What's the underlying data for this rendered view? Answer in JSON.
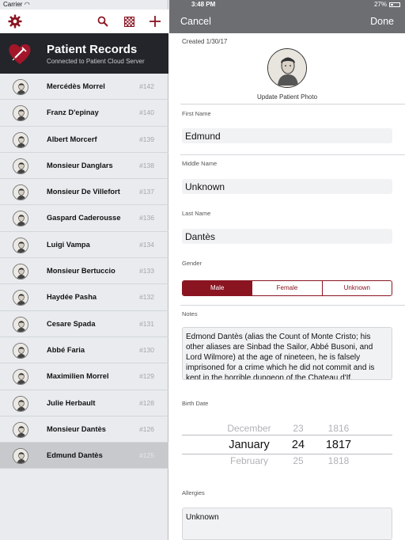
{
  "status_bar": {
    "carrier": "Carrier",
    "time": "3:48 PM",
    "battery": "27%"
  },
  "toolbar": {
    "icons": [
      "gear-icon",
      "search-icon",
      "checkerboard-icon",
      "plus-icon"
    ]
  },
  "header": {
    "title": "Patient Records",
    "subtitle": "Connected to Patient Cloud Server"
  },
  "patients": [
    {
      "name": "Mercédès Morrel",
      "id": "#142"
    },
    {
      "name": "Franz D'epinay",
      "id": "#140"
    },
    {
      "name": "Albert Morcerf",
      "id": "#139"
    },
    {
      "name": "Monsieur Danglars",
      "id": "#138"
    },
    {
      "name": "Monsieur De Villefort",
      "id": "#137"
    },
    {
      "name": "Gaspard Caderousse",
      "id": "#136"
    },
    {
      "name": "Luigi Vampa",
      "id": "#134"
    },
    {
      "name": "Monsieur  Bertuccio",
      "id": "#133"
    },
    {
      "name": "Haydée Pasha",
      "id": "#132"
    },
    {
      "name": "Cesare Spada",
      "id": "#131"
    },
    {
      "name": "Abbé Faria",
      "id": "#130"
    },
    {
      "name": "Maximilien Morrel",
      "id": "#129"
    },
    {
      "name": "Julie Herbault",
      "id": "#128"
    },
    {
      "name": "Monsieur Dantès",
      "id": "#126"
    },
    {
      "name": "Edmund Dantès",
      "id": "#125"
    }
  ],
  "detail": {
    "nav": {
      "cancel": "Cancel",
      "done": "Done"
    },
    "created": "Created 1/30/17",
    "photo_label": "Update Patient Photo",
    "first_name": {
      "label": "First Name",
      "value": "Edmund"
    },
    "middle_name": {
      "label": "Middle Name",
      "value": "Unknown"
    },
    "last_name": {
      "label": "Last Name",
      "value": "Dantès"
    },
    "gender": {
      "label": "Gender",
      "options": [
        "Male",
        "Female",
        "Unknown"
      ],
      "selected": "Male"
    },
    "notes": {
      "label": "Notes",
      "value": "Edmond Dantès (alias the Count of Monte Cristo; his other aliases are Sinbad the Sailor, Abbé Busoni, and Lord Wilmore) at the age of nineteen, he is falsely imprisoned for a crime which he did not commit and is kept in the horrible dungeon of the Chateau d'If."
    },
    "birth_date": {
      "label": "Birth Date",
      "month": {
        "prev": "December",
        "current": "January",
        "next": "February"
      },
      "day": {
        "prev": "23",
        "current": "24",
        "next": "25"
      },
      "year": {
        "prev": "1816",
        "current": "1817",
        "next": "1818"
      }
    },
    "allergies": {
      "label": "Allergies",
      "value": "Unknown"
    }
  },
  "colors": {
    "accent": "#8a1521",
    "header_bg": "#23252a",
    "nav_bg": "#6c6e72",
    "list_bg": "#e9ebee",
    "selected_row": "#c7c9cd"
  }
}
